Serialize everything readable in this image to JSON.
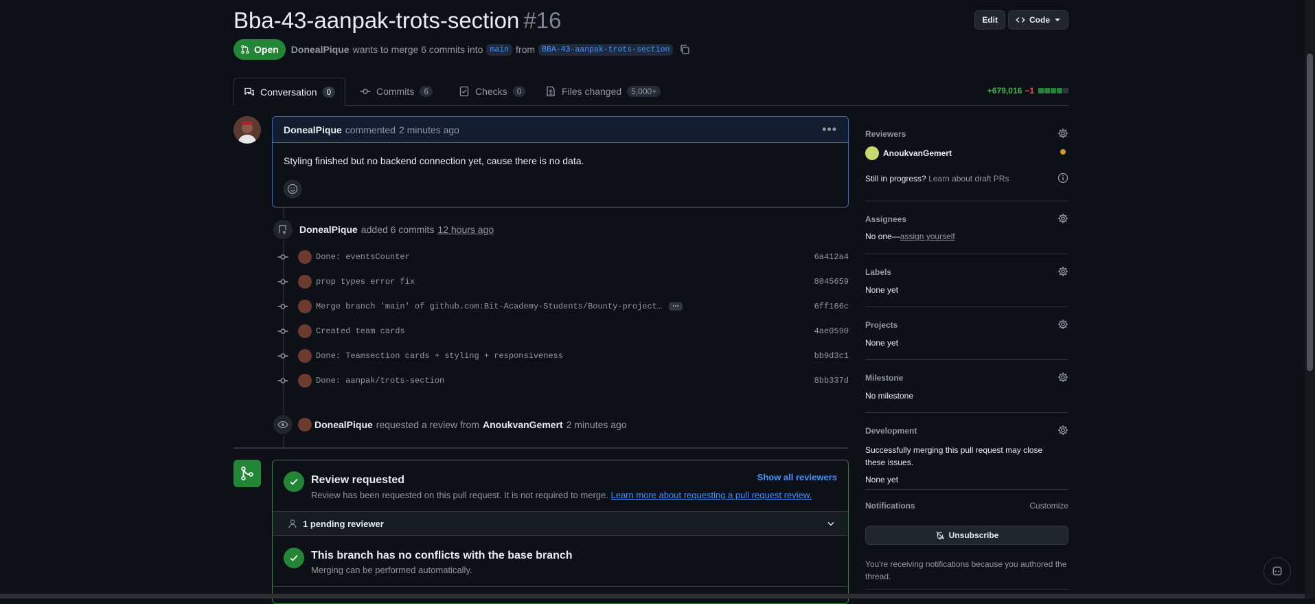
{
  "pr": {
    "title": "Bba-43-aanpak-trots-section",
    "number": "#16",
    "state": "Open",
    "author": "DonealPique",
    "merge_text": "wants to merge 6 commits into",
    "base_branch": "main",
    "from_text": "from",
    "head_branch": "BBA-43-aanpak-trots-section"
  },
  "header": {
    "edit_label": "Edit",
    "code_label": "Code"
  },
  "tabs": [
    {
      "label": "Conversation",
      "count": "0"
    },
    {
      "label": "Commits",
      "count": "6"
    },
    {
      "label": "Checks",
      "count": "0"
    },
    {
      "label": "Files changed",
      "count": "5,000+"
    }
  ],
  "diffstat": {
    "additions": "+679,016",
    "deletions": "−1",
    "blocks": [
      "#238636",
      "#238636",
      "#238636",
      "#238636",
      "#2f3640"
    ]
  },
  "comment": {
    "author": "DonealPique",
    "action": "commented",
    "time": "2 minutes ago",
    "body": "Styling finished but no backend connection yet, cause there is no data."
  },
  "commits_event": {
    "author": "DonealPique",
    "action": "added 6 commits",
    "time": "12 hours ago"
  },
  "commits": [
    {
      "message": "Done: eventsCounter",
      "sha": "6a412a4",
      "more": false
    },
    {
      "message": "prop types error fix",
      "sha": "8045659",
      "more": false
    },
    {
      "message": "Merge branch 'main' of github.com:Bit-Academy-Students/Bounty-project…",
      "sha": "6ff166c",
      "more": true,
      "more_label": "…"
    },
    {
      "message": "Created team cards",
      "sha": "4ae0590",
      "more": false
    },
    {
      "message": "Done: Teamsection cards + styling + responsiveness",
      "sha": "bb9d3c1",
      "more": false
    },
    {
      "message": "Done: aanpak/trots-section",
      "sha": "8bb337d",
      "more": false
    }
  ],
  "review_event": {
    "author": "DonealPique",
    "action": "requested a review from",
    "reviewer": "AnoukvanGemert",
    "time": "2 minutes ago"
  },
  "merge_box": {
    "review_title": "Review requested",
    "review_sub": "Review has been requested on this pull request. It is not required to merge.",
    "review_link": "Learn more about requesting a pull request review.",
    "show_all": "Show all reviewers",
    "pending": "1 pending reviewer",
    "conflict_title": "This branch has no conflicts with the base branch",
    "conflict_sub": "Merging can be performed automatically."
  },
  "sidebar": {
    "reviewers_label": "Reviewers",
    "reviewer_name": "AnoukvanGemert",
    "draft_q": "Still in progress?",
    "draft_link": "Learn about draft PRs",
    "assignees_label": "Assignees",
    "assignees_none": "No one—",
    "assign_yourself": "assign yourself",
    "labels_label": "Labels",
    "labels_value": "None yet",
    "projects_label": "Projects",
    "projects_value": "None yet",
    "milestone_label": "Milestone",
    "milestone_value": "No milestone",
    "development_label": "Development",
    "development_text": "Successfully merging this pull request may close these issues.",
    "development_value": "None yet",
    "notifications_label": "Notifications",
    "customize": "Customize",
    "unsubscribe": "Unsubscribe",
    "notif_reason": "You're receiving notifications because you authored the thread."
  }
}
